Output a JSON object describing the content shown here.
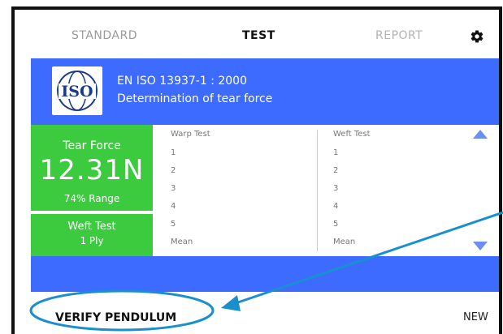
{
  "tabs": {
    "standard": "STANDARD",
    "test": "TEST",
    "report": "REPORT",
    "settings_icon": "gear-icon"
  },
  "header": {
    "logo_text": "ISO",
    "standard": "EN ISO 13937-1 : 2000",
    "description": "Determination of tear force"
  },
  "result": {
    "label": "Tear Force",
    "value": "12.31N",
    "range": "74% Range"
  },
  "test_mode": {
    "line1": "Weft Test",
    "line2": "1 Ply"
  },
  "warp": {
    "title": "Warp Test",
    "rows": [
      "1",
      "2",
      "3",
      "4",
      "5"
    ],
    "mean": "Mean"
  },
  "weft": {
    "title": "Weft Test",
    "rows": [
      "1",
      "2",
      "3",
      "4",
      "5"
    ],
    "mean": "Mean"
  },
  "bottom": {
    "verify": "VERIFY PENDULUM",
    "new": "NEW"
  },
  "colors": {
    "accent_blue": "#3d6bff",
    "result_green": "#3ccb3f",
    "annotation_blue": "#1a8fd0"
  }
}
